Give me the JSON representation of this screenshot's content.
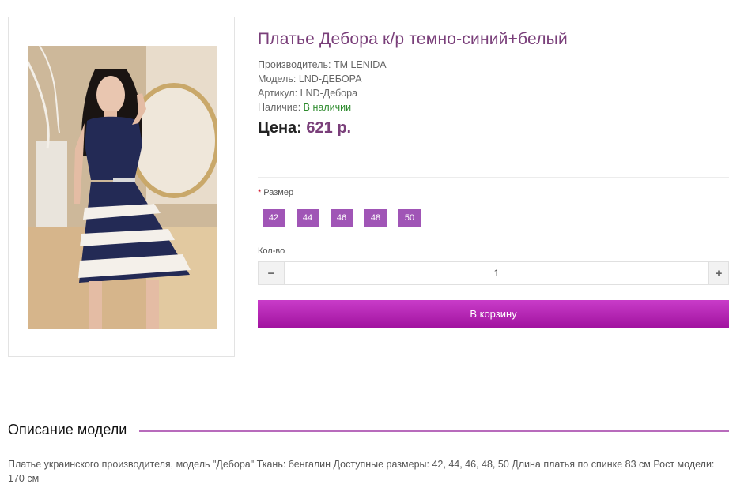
{
  "product": {
    "title": "Платье Дебора к/р темно-синий+белый",
    "manufacturer_label": "Производитель:",
    "manufacturer": "TM LENIDA",
    "model_label": "Модель:",
    "model": "LND-ДЕБОРА",
    "sku_label": "Артикул:",
    "sku": "LND-Дебора",
    "availability_label": "Наличие:",
    "availability": "В наличии",
    "price_label": "Цена:",
    "price": "621 р."
  },
  "options": {
    "size_required_mark": "*",
    "size_label": "Размер",
    "sizes": [
      "42",
      "44",
      "46",
      "48",
      "50"
    ],
    "qty_label": "Кол-во",
    "qty_value": "1",
    "minus": "−",
    "plus": "+"
  },
  "cart_button": "В корзину",
  "description": {
    "title": "Описание модели",
    "text": "Платье украинского производителя, модель \"Дебора\" Ткань: бенгалин Доступные размеры: 42, 44, 46, 48, 50 Длина платья по спинке 83 см Рост модели: 170 см"
  },
  "colors": {
    "accent": "#a055b6",
    "title": "#7a3f7a",
    "button": "#b427b2",
    "in_stock": "#2e8b2e"
  }
}
